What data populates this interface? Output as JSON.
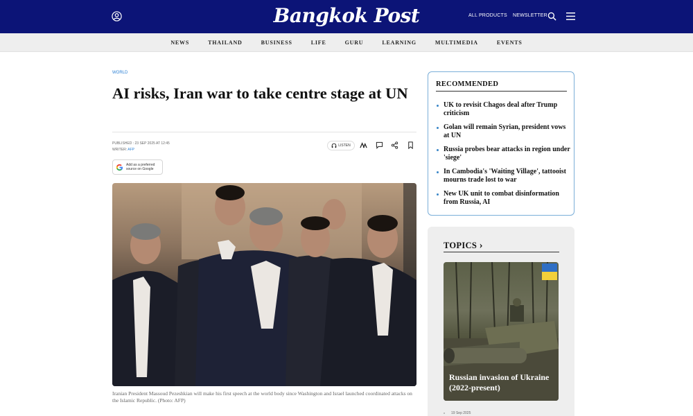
{
  "header": {
    "logo": "Bangkok Post",
    "links": [
      "ALL PRODUCTS",
      "NEWSLETTER"
    ],
    "brand_color": "#0c1477"
  },
  "nav": {
    "items": [
      "NEWS",
      "THAILAND",
      "BUSINESS",
      "LIFE",
      "GURU",
      "LEARNING",
      "MULTIMEDIA",
      "EVENTS"
    ]
  },
  "article": {
    "section": "WORLD",
    "headline": "AI risks, Iran war to take centre stage at UN",
    "published_label": "PUBLISHED : 23 SEP 2025 AT 12:45",
    "writer_label": "WRITER:",
    "writer": "AFP",
    "listen_label": "LISTEN",
    "google_badge_line1": "Add as a preferred",
    "google_badge_line2": "source on Google",
    "caption": "Iranian President Massoud Pezeshkian will make his first speech at the world body since Washington and Israel launched coordinated attacks on the Islamic Republic. (Photo: AFP)"
  },
  "recommended": {
    "title": "RECOMMENDED",
    "items": [
      "UK to revisit Chagos deal after Trump criticism",
      "Golan will remain Syrian, president vows at UN",
      "Russia probes bear attacks in region under 'siege'",
      "In Cambodia's 'Waiting Village', tattooist mourns trade lost to war",
      "New UK unit to combat disinformation from Russia, AI"
    ]
  },
  "topics": {
    "title": "TOPICS",
    "chevron": "›",
    "card_label": "Russian invasion of Ukraine (2022-present)",
    "date": "19 Sep 2025"
  }
}
